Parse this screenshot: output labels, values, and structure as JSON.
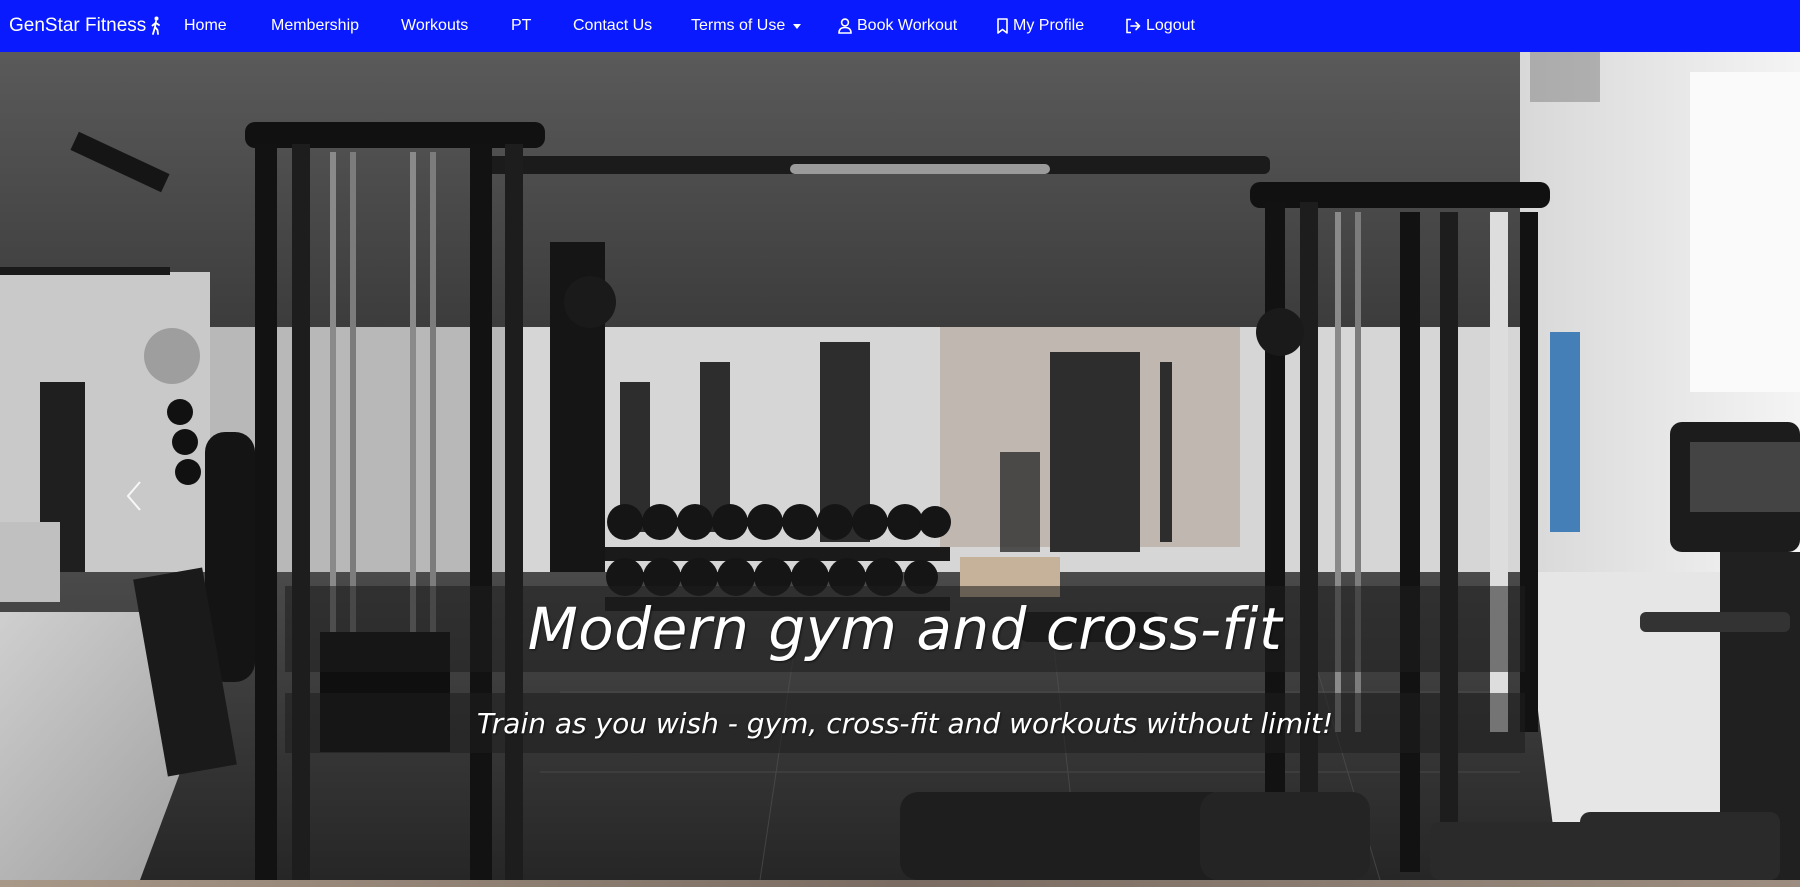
{
  "brand": {
    "name": "GenStar Fitness",
    "icon": "walking-person-icon"
  },
  "nav": {
    "home": "Home",
    "membership": "Membership",
    "workouts": "Workouts",
    "pt": "PT",
    "contact": "Contact Us",
    "terms": "Terms of Use",
    "book": "Book Workout",
    "profile": "My Profile",
    "logout": "Logout"
  },
  "nav_icons": {
    "book": "person-icon",
    "profile": "bookmark-icon",
    "logout": "logout-icon",
    "terms": "caret-down-icon"
  },
  "hero": {
    "title": "Modern gym and cross-fit",
    "subtitle": "Train as you wish - gym, cross-fit and workouts without limit!",
    "image_alt": "gym-interior-photo"
  },
  "colors": {
    "navbar_bg": "#0a1aff",
    "nav_text": "#ffffff",
    "caption_bg": "rgba(30,30,30,0.55)"
  }
}
